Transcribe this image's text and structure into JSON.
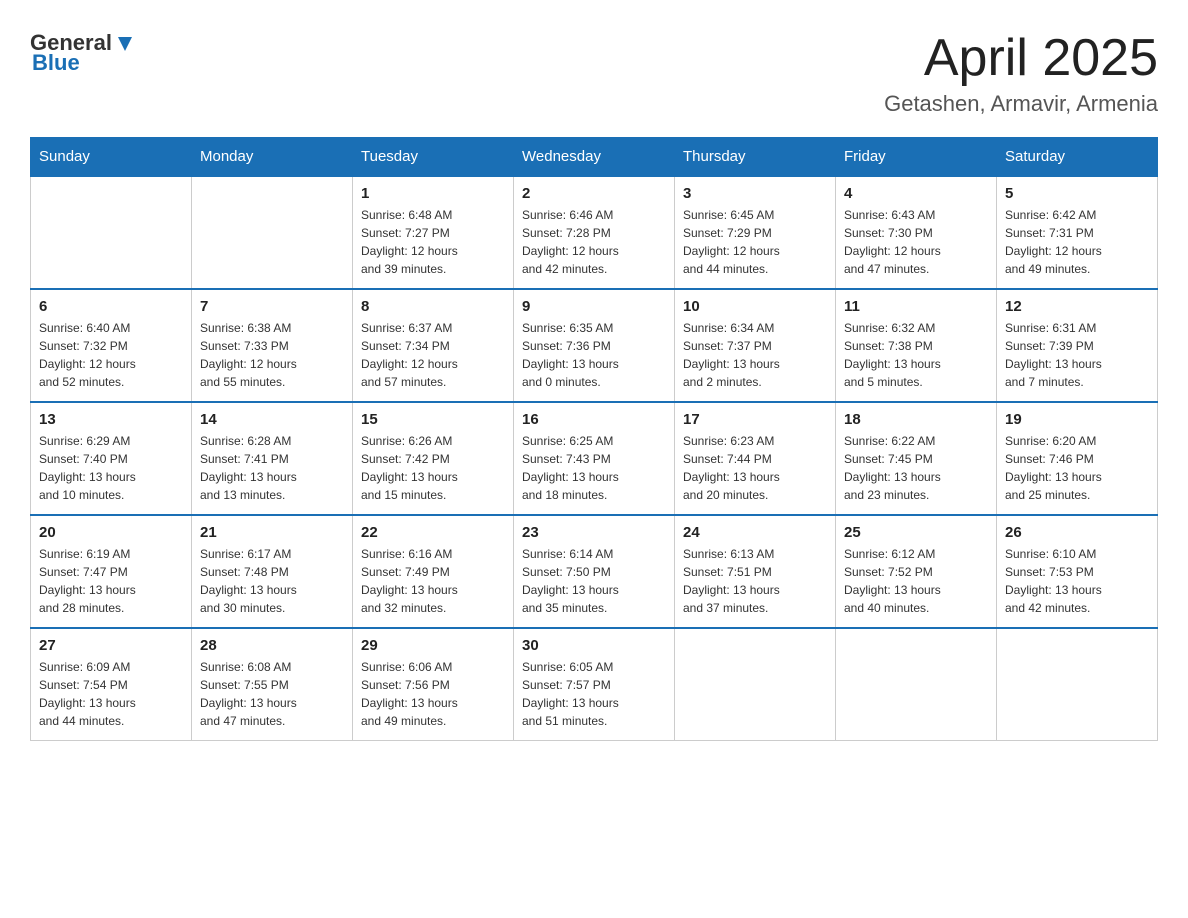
{
  "header": {
    "logo": {
      "general": "General",
      "blue": "Blue"
    },
    "title": "April 2025",
    "subtitle": "Getashen, Armavir, Armenia"
  },
  "days_of_week": [
    "Sunday",
    "Monday",
    "Tuesday",
    "Wednesday",
    "Thursday",
    "Friday",
    "Saturday"
  ],
  "weeks": [
    [
      {
        "day": "",
        "info": ""
      },
      {
        "day": "",
        "info": ""
      },
      {
        "day": "1",
        "info": "Sunrise: 6:48 AM\nSunset: 7:27 PM\nDaylight: 12 hours\nand 39 minutes."
      },
      {
        "day": "2",
        "info": "Sunrise: 6:46 AM\nSunset: 7:28 PM\nDaylight: 12 hours\nand 42 minutes."
      },
      {
        "day": "3",
        "info": "Sunrise: 6:45 AM\nSunset: 7:29 PM\nDaylight: 12 hours\nand 44 minutes."
      },
      {
        "day": "4",
        "info": "Sunrise: 6:43 AM\nSunset: 7:30 PM\nDaylight: 12 hours\nand 47 minutes."
      },
      {
        "day": "5",
        "info": "Sunrise: 6:42 AM\nSunset: 7:31 PM\nDaylight: 12 hours\nand 49 minutes."
      }
    ],
    [
      {
        "day": "6",
        "info": "Sunrise: 6:40 AM\nSunset: 7:32 PM\nDaylight: 12 hours\nand 52 minutes."
      },
      {
        "day": "7",
        "info": "Sunrise: 6:38 AM\nSunset: 7:33 PM\nDaylight: 12 hours\nand 55 minutes."
      },
      {
        "day": "8",
        "info": "Sunrise: 6:37 AM\nSunset: 7:34 PM\nDaylight: 12 hours\nand 57 minutes."
      },
      {
        "day": "9",
        "info": "Sunrise: 6:35 AM\nSunset: 7:36 PM\nDaylight: 13 hours\nand 0 minutes."
      },
      {
        "day": "10",
        "info": "Sunrise: 6:34 AM\nSunset: 7:37 PM\nDaylight: 13 hours\nand 2 minutes."
      },
      {
        "day": "11",
        "info": "Sunrise: 6:32 AM\nSunset: 7:38 PM\nDaylight: 13 hours\nand 5 minutes."
      },
      {
        "day": "12",
        "info": "Sunrise: 6:31 AM\nSunset: 7:39 PM\nDaylight: 13 hours\nand 7 minutes."
      }
    ],
    [
      {
        "day": "13",
        "info": "Sunrise: 6:29 AM\nSunset: 7:40 PM\nDaylight: 13 hours\nand 10 minutes."
      },
      {
        "day": "14",
        "info": "Sunrise: 6:28 AM\nSunset: 7:41 PM\nDaylight: 13 hours\nand 13 minutes."
      },
      {
        "day": "15",
        "info": "Sunrise: 6:26 AM\nSunset: 7:42 PM\nDaylight: 13 hours\nand 15 minutes."
      },
      {
        "day": "16",
        "info": "Sunrise: 6:25 AM\nSunset: 7:43 PM\nDaylight: 13 hours\nand 18 minutes."
      },
      {
        "day": "17",
        "info": "Sunrise: 6:23 AM\nSunset: 7:44 PM\nDaylight: 13 hours\nand 20 minutes."
      },
      {
        "day": "18",
        "info": "Sunrise: 6:22 AM\nSunset: 7:45 PM\nDaylight: 13 hours\nand 23 minutes."
      },
      {
        "day": "19",
        "info": "Sunrise: 6:20 AM\nSunset: 7:46 PM\nDaylight: 13 hours\nand 25 minutes."
      }
    ],
    [
      {
        "day": "20",
        "info": "Sunrise: 6:19 AM\nSunset: 7:47 PM\nDaylight: 13 hours\nand 28 minutes."
      },
      {
        "day": "21",
        "info": "Sunrise: 6:17 AM\nSunset: 7:48 PM\nDaylight: 13 hours\nand 30 minutes."
      },
      {
        "day": "22",
        "info": "Sunrise: 6:16 AM\nSunset: 7:49 PM\nDaylight: 13 hours\nand 32 minutes."
      },
      {
        "day": "23",
        "info": "Sunrise: 6:14 AM\nSunset: 7:50 PM\nDaylight: 13 hours\nand 35 minutes."
      },
      {
        "day": "24",
        "info": "Sunrise: 6:13 AM\nSunset: 7:51 PM\nDaylight: 13 hours\nand 37 minutes."
      },
      {
        "day": "25",
        "info": "Sunrise: 6:12 AM\nSunset: 7:52 PM\nDaylight: 13 hours\nand 40 minutes."
      },
      {
        "day": "26",
        "info": "Sunrise: 6:10 AM\nSunset: 7:53 PM\nDaylight: 13 hours\nand 42 minutes."
      }
    ],
    [
      {
        "day": "27",
        "info": "Sunrise: 6:09 AM\nSunset: 7:54 PM\nDaylight: 13 hours\nand 44 minutes."
      },
      {
        "day": "28",
        "info": "Sunrise: 6:08 AM\nSunset: 7:55 PM\nDaylight: 13 hours\nand 47 minutes."
      },
      {
        "day": "29",
        "info": "Sunrise: 6:06 AM\nSunset: 7:56 PM\nDaylight: 13 hours\nand 49 minutes."
      },
      {
        "day": "30",
        "info": "Sunrise: 6:05 AM\nSunset: 7:57 PM\nDaylight: 13 hours\nand 51 minutes."
      },
      {
        "day": "",
        "info": ""
      },
      {
        "day": "",
        "info": ""
      },
      {
        "day": "",
        "info": ""
      }
    ]
  ]
}
